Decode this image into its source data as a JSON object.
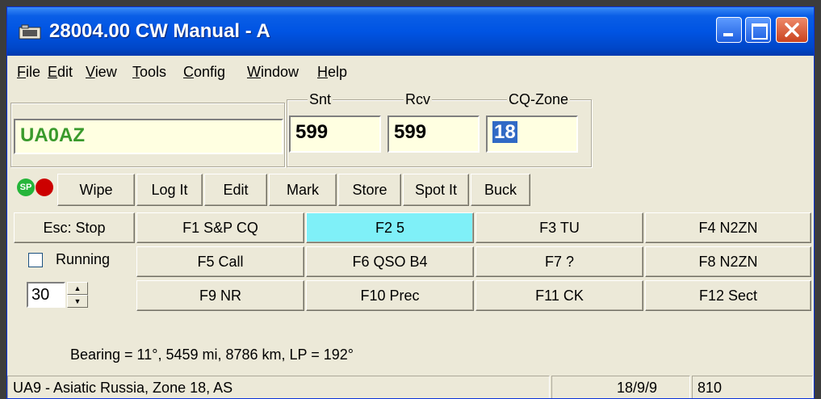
{
  "window": {
    "title": "28004.00 CW Manual - A"
  },
  "menu": [
    "File",
    "Edit",
    "View",
    "Tools",
    "Config",
    "Window",
    "Help"
  ],
  "entry": {
    "call": "UA0AZ",
    "snt_label": "Snt",
    "snt": "599",
    "rcv_label": "Rcv",
    "rcv": "599",
    "zone_label": "CQ-Zone",
    "zone": "18"
  },
  "toolbar": {
    "sp_badge": "SP",
    "buttons": [
      "Wipe",
      "Log It",
      "Edit",
      "Mark",
      "Store",
      "Spot It",
      "Buck"
    ]
  },
  "esc_label": "Esc: Stop",
  "running_label": "Running",
  "spin_value": "30",
  "fkeys": [
    [
      "F1 S&P CQ",
      "F2 5",
      "F3 TU",
      "F4 N2ZN"
    ],
    [
      "F5 Call",
      "F6 QSO B4",
      "F7 ?",
      "F8 N2ZN"
    ],
    [
      "F9 NR",
      "F10 Prec",
      "F11 CK",
      "F12 Sect"
    ]
  ],
  "bearing": "Bearing = 11°, 5459  mi, 8786 km, LP = 192°",
  "status": {
    "country": "UA9 - Asiatic Russia, Zone 18, AS",
    "date": "18/9/9",
    "count": "810"
  },
  "colors": {
    "call_text": "#3a9a2c",
    "highlight_fkey": "#7ff0f8",
    "sp_green": "#25b53a",
    "stop_red": "#cc0000"
  }
}
